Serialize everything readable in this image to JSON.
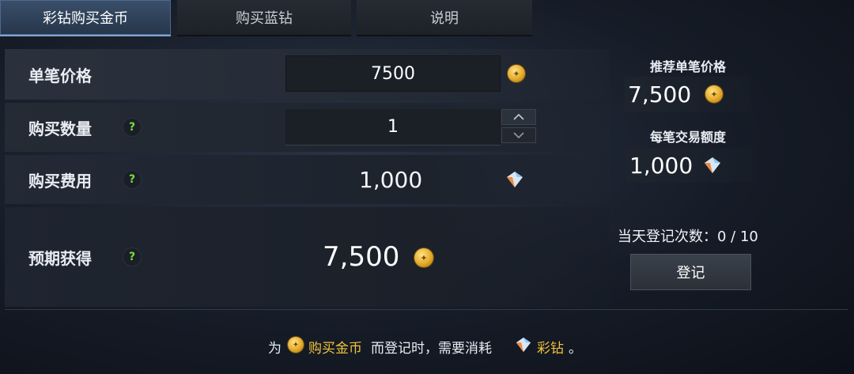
{
  "tabs": [
    {
      "label": "彩钻购买金币",
      "active": true
    },
    {
      "label": "购买蓝钻",
      "active": false
    },
    {
      "label": "说明",
      "active": false
    }
  ],
  "form": {
    "unit_price_label": "单笔价格",
    "unit_price_value": "7500",
    "quantity_label": "购买数量",
    "quantity_value": "1",
    "cost_label": "购买费用",
    "cost_value": "1,000",
    "expected_label": "预期获得",
    "expected_value": "7,500",
    "help_glyph": "?"
  },
  "right_panel": {
    "recommended_price_label": "推荐单笔价格",
    "recommended_price_value": "7,500",
    "per_trade_limit_label": "每笔交易额度",
    "per_trade_limit_value": "1,000",
    "daily_register_label": "当天登记次数：",
    "daily_register_count": "0 / 10",
    "register_button": "登记"
  },
  "footer": {
    "prefix": "为",
    "link1": "购买金币",
    "middle": "而登记时，需要消耗",
    "link2": "彩钻",
    "suffix": "。"
  },
  "icons": {
    "gold_coin": "gold-coin-icon",
    "color_diamond": "color-diamond-icon",
    "stepper_up": "chevron-up-icon",
    "stepper_down": "chevron-down-icon"
  },
  "colors": {
    "active_tab": "#3a4f6a",
    "help_icon": "#7fdc3a",
    "highlight": "#f0c23a"
  }
}
